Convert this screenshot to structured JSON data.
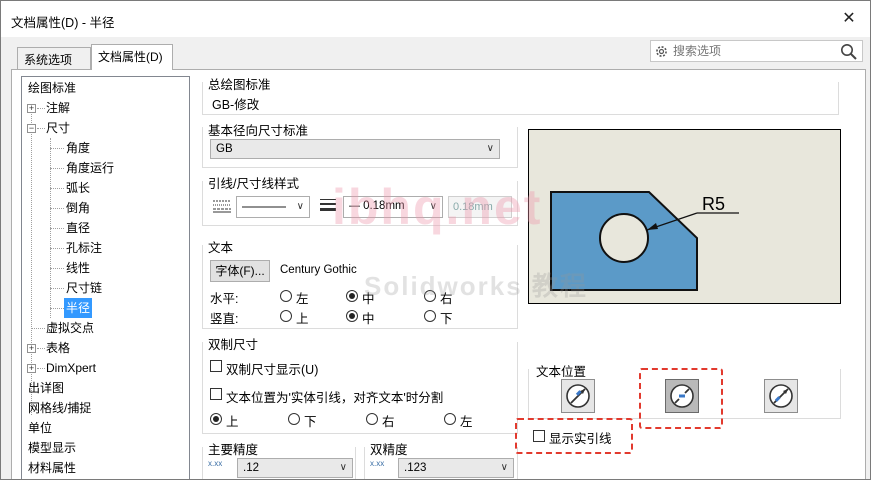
{
  "window": {
    "title": "文档属性(D) - 半径",
    "close_glyph": "✕"
  },
  "tabs": [
    {
      "label": "系统选项(S)"
    },
    {
      "label": "文档属性(D)"
    }
  ],
  "search": {
    "placeholder": "搜索选项"
  },
  "tree": {
    "items": [
      {
        "label": "绘图标准"
      },
      {
        "label": "注解"
      },
      {
        "label": "尺寸"
      },
      {
        "label": "角度"
      },
      {
        "label": "角度运行"
      },
      {
        "label": "弧长"
      },
      {
        "label": "倒角"
      },
      {
        "label": "直径"
      },
      {
        "label": "孔标注"
      },
      {
        "label": "线性"
      },
      {
        "label": "尺寸链"
      },
      {
        "label": "半径"
      },
      {
        "label": "虚拟交点"
      },
      {
        "label": "表格"
      },
      {
        "label": "DimXpert"
      },
      {
        "label": "出详图"
      },
      {
        "label": "网格线/捕捉"
      },
      {
        "label": "单位"
      },
      {
        "label": "模型显示"
      },
      {
        "label": "材料属性"
      }
    ]
  },
  "overall_standard": {
    "title": "总绘图标准",
    "value": "GB-修改"
  },
  "base_standard": {
    "title": "基本径向尺寸标准",
    "value": "GB"
  },
  "leader_style": {
    "title": "引线/尺寸线样式",
    "thickness_value": "0.18mm",
    "custom_thickness": "0.18mm"
  },
  "text": {
    "title": "文本",
    "font_button": "字体(F)...",
    "font_name": "Century Gothic",
    "horizontal_label": "水平:",
    "vertical_label": "竖直:",
    "horizontal_options": [
      "左",
      "中",
      "右"
    ],
    "vertical_options": [
      "上",
      "中",
      "下"
    ],
    "horizontal_selected": "中",
    "vertical_selected": "中"
  },
  "dual": {
    "title": "双制尺寸",
    "show_dual": "双制尺寸显示(U)",
    "split_text": "文本位置为'实体引线，对齐文本'时分割",
    "position_options": [
      "上",
      "下",
      "右",
      "左"
    ],
    "position_selected": "上"
  },
  "precision": {
    "primary_title": "主要精度",
    "primary_value": ".12",
    "dual_title": "双精度",
    "dual_value": ".123",
    "icon_glyph": "x.xx"
  },
  "preview": {
    "dimension_text": "R5"
  },
  "text_position": {
    "title": "文本位置",
    "show_solid_leader": "显示实引线",
    "selected_index": 1
  },
  "watermark": {
    "line1": "ibhq.net",
    "line2": "Solidworks 教程"
  },
  "colors": {
    "selection": "#3399ff",
    "preview_bg": "#e8e7dc",
    "part_fill": "#5b9ac8",
    "highlight_dash": "#e23a2e"
  }
}
